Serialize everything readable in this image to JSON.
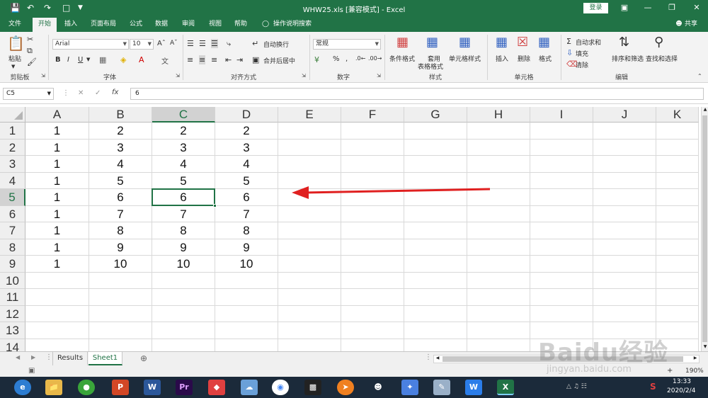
{
  "window": {
    "title": "WHW25.xls  [兼容模式]  -  Excel",
    "login_label": "登录"
  },
  "menu_tabs": [
    "文件",
    "开始",
    "插入",
    "页面布局",
    "公式",
    "数据",
    "审阅",
    "视图",
    "帮助"
  ],
  "tell_me": "操作说明搜索",
  "share": "共享",
  "ribbon": {
    "clipboard": {
      "paste": "粘贴",
      "label": "剪贴板"
    },
    "font": {
      "name": "Arial",
      "size": "10",
      "bold": "B",
      "italic": "I",
      "underline": "U",
      "label": "字体"
    },
    "alignment": {
      "wrap": "自动换行",
      "merge": "合并后居中",
      "label": "对齐方式"
    },
    "number": {
      "format": "常规",
      "percent": "%",
      "comma": ",",
      "label": "数字"
    },
    "styles": {
      "conditional": "条件格式",
      "table_line1": "套用",
      "table_line2": "表格格式",
      "cell_styles": "单元格样式",
      "label": "样式"
    },
    "cells": {
      "insert": "插入",
      "delete": "删除",
      "format": "格式",
      "label": "单元格"
    },
    "editing": {
      "autosum": "自动求和",
      "fill": "填充",
      "clear": "清除",
      "sort": "排序和筛选",
      "find": "查找和选择",
      "label": "编辑"
    }
  },
  "formula_bar": {
    "name_box": "C5",
    "fx": "fx",
    "value": "6"
  },
  "columns": [
    "A",
    "B",
    "C",
    "D",
    "E",
    "F",
    "G",
    "H",
    "I",
    "J",
    "K"
  ],
  "rows": [
    "1",
    "2",
    "3",
    "4",
    "5",
    "6",
    "7",
    "8",
    "9",
    "10",
    "11",
    "12",
    "13",
    "14"
  ],
  "cells": [
    [
      "1",
      "2",
      "2",
      "2"
    ],
    [
      "1",
      "3",
      "3",
      "3"
    ],
    [
      "1",
      "4",
      "4",
      "4"
    ],
    [
      "1",
      "5",
      "5",
      "5"
    ],
    [
      "1",
      "6",
      "6",
      "6"
    ],
    [
      "1",
      "7",
      "7",
      "7"
    ],
    [
      "1",
      "8",
      "8",
      "8"
    ],
    [
      "1",
      "9",
      "9",
      "9"
    ],
    [
      "1",
      "10",
      "10",
      "10"
    ]
  ],
  "selected_cell": "C5",
  "sheet_tabs": [
    "Results",
    "Sheet1"
  ],
  "active_sheet": "Sheet1",
  "status": {
    "zoom": "190%"
  },
  "taskbar": {
    "time": "13:33",
    "date": "2020/2/4"
  },
  "watermark": {
    "brand": "Baidu经验",
    "url": "jingyan.baidu.com"
  },
  "colors": {
    "excel_green": "#217346",
    "arrow_red": "#e02020"
  }
}
